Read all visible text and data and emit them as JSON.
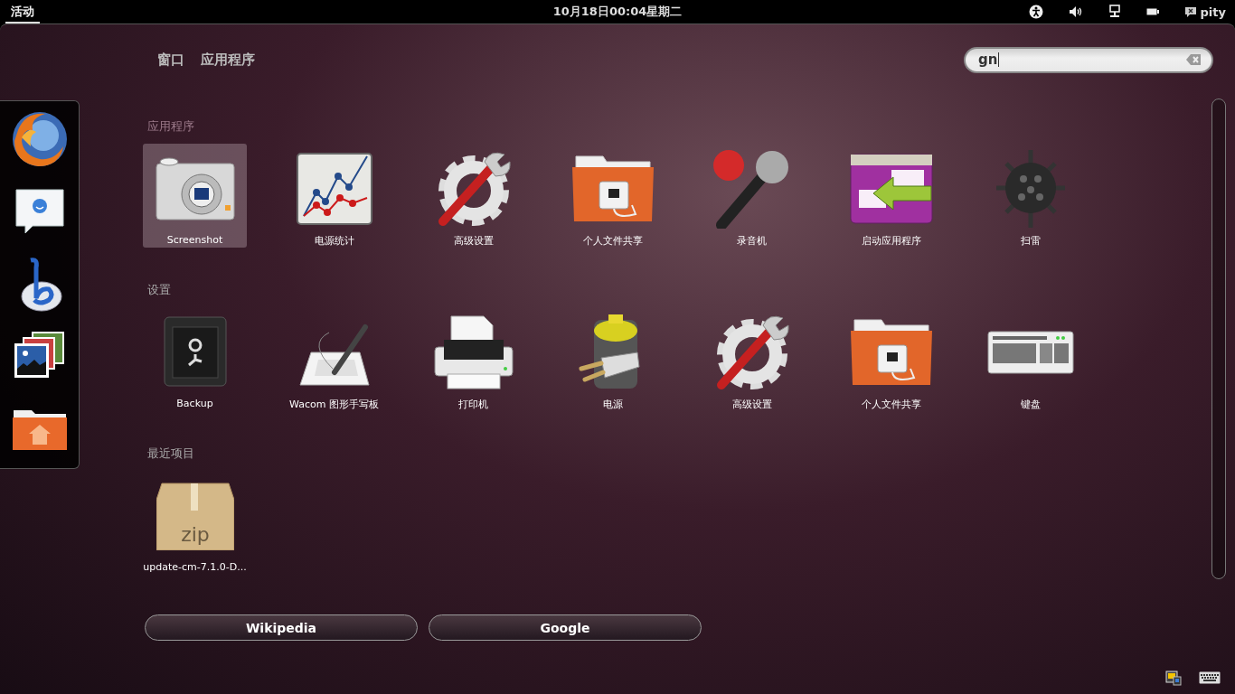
{
  "top_bar": {
    "activities": {
      "label": "活动",
      "selected": true
    },
    "clock": "10月18日00:04星期二",
    "user": "pity"
  },
  "view_tabs": [
    {
      "label": "窗口",
      "selected": false
    },
    {
      "label": "应用程序",
      "selected": false
    }
  ],
  "search": {
    "value": "gn"
  },
  "sections": [
    {
      "title": "应用程序",
      "items": [
        {
          "label": "Screenshot",
          "selected": true
        },
        {
          "label": "电源统计",
          "selected": false
        },
        {
          "label": "高级设置",
          "selected": false
        },
        {
          "label": "个人文件共享",
          "selected": false
        },
        {
          "label": "录音机",
          "selected": false
        },
        {
          "label": "启动应用程序",
          "selected": false
        },
        {
          "label": "扫雷",
          "selected": false
        }
      ]
    },
    {
      "title": "设置",
      "items": [
        {
          "label": "Backup",
          "selected": false
        },
        {
          "label": "Wacom 图形手写板",
          "selected": false
        },
        {
          "label": "打印机",
          "selected": false
        },
        {
          "label": "电源",
          "selected": false
        },
        {
          "label": "高级设置",
          "selected": false
        },
        {
          "label": "个人文件共享",
          "selected": false
        },
        {
          "label": "键盘",
          "selected": false
        }
      ]
    },
    {
      "title": "最近项目",
      "items": [
        {
          "label": "update-cm-7.1.0-D...",
          "selected": false,
          "icon_text": "zip"
        }
      ]
    }
  ],
  "search_providers": [
    "Wikipedia",
    "Google"
  ]
}
